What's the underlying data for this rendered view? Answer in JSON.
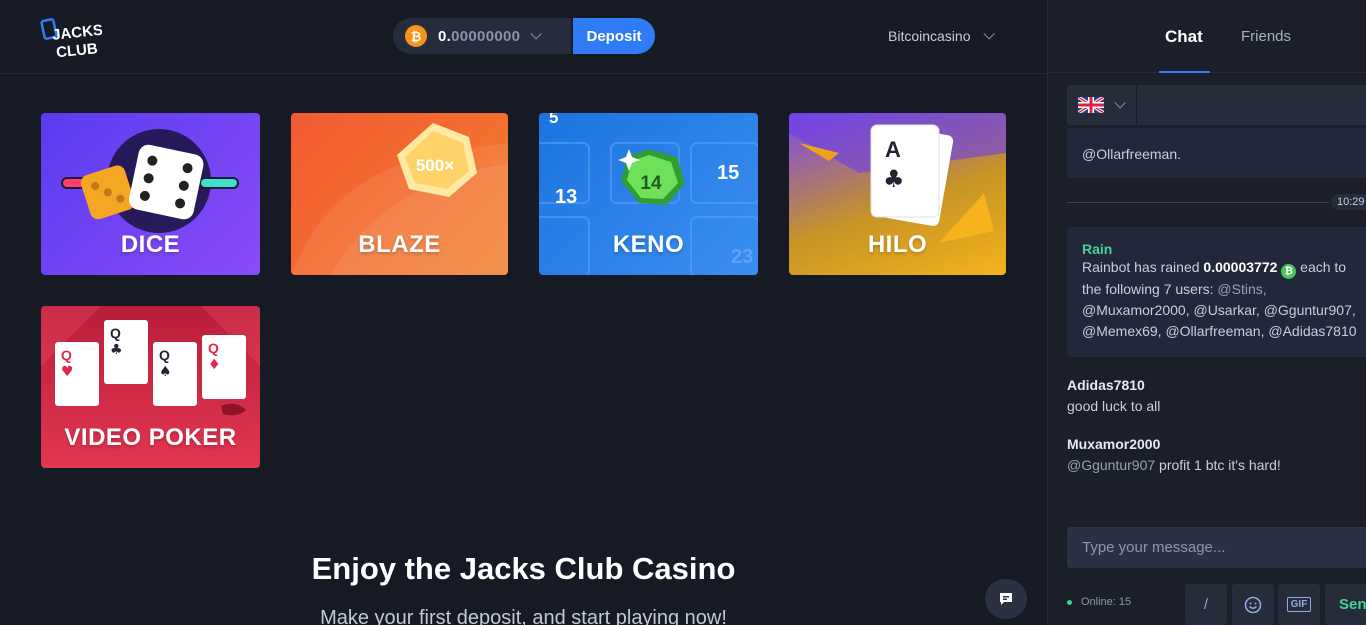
{
  "header": {
    "logo_text": "JACKS CLUB",
    "balance_currency_icon": "bitcoin-icon",
    "balance_prefix": "0.",
    "balance_rest": "00000000",
    "deposit_label": "Deposit",
    "account_name": "Bitcoincasino"
  },
  "games": [
    {
      "title": "DICE"
    },
    {
      "title": "BLAZE",
      "badge": "500×"
    },
    {
      "title": "KENO",
      "numbers": [
        "5",
        "13",
        "14",
        "15",
        "23"
      ]
    },
    {
      "title": "HILO",
      "card": "A"
    },
    {
      "title": "VIDEO POKER",
      "card": "Q"
    }
  ],
  "cta": {
    "title": "Enjoy the Jacks Club Casino",
    "subtitle": "Make your first deposit, and start playing now!"
  },
  "chat": {
    "tabs": {
      "chat": "Chat",
      "friends": "Friends"
    },
    "language_flag": "uk-flag-icon",
    "top_message_mention": "@Ollarfreeman.",
    "timestamp": "10:29",
    "rain": {
      "title": "Rain",
      "line1_prefix": "Rainbot has rained ",
      "amount": "0.00003772",
      "line1_suffix": " each to",
      "line2_prefix": "the following 7 users: ",
      "line2_mention": "@Stins,",
      "line3": "@Muxamor2000, @Usarkar, @Gguntur907,",
      "line4": "@Memex69, @Ollarfreeman, @Adidas7810"
    },
    "messages": [
      {
        "user": "Adidas7810",
        "text": "good luck to all",
        "mention": ""
      },
      {
        "user": "Muxamor2000",
        "mention": "@Gguntur907",
        "text": " profit 1 btc it's hard!"
      }
    ],
    "input_placeholder": "Type your message...",
    "online_label": "Online: 15",
    "slash_label": "/",
    "gif_label": "GIF",
    "send_label": "Send"
  }
}
